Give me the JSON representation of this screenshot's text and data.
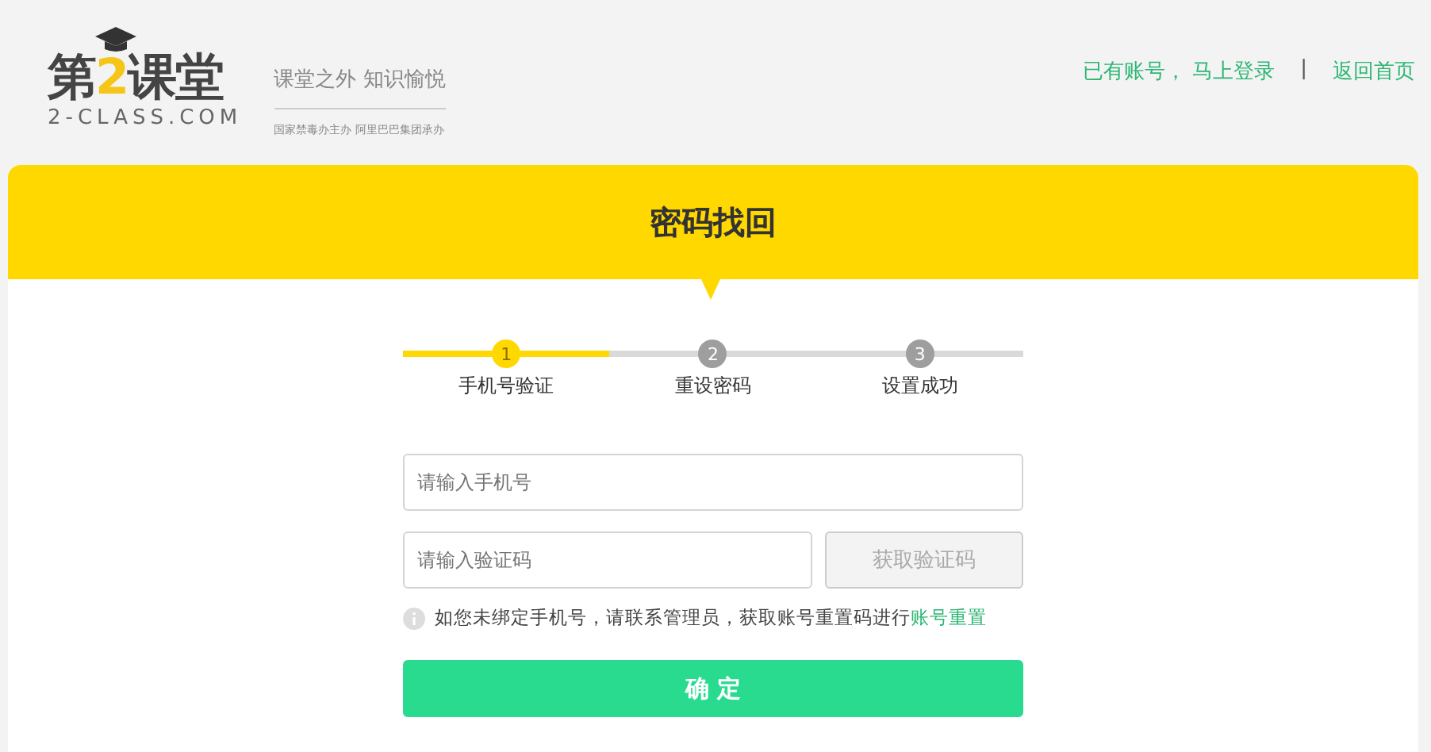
{
  "logo": {
    "name_before": "第",
    "name_digit": "2",
    "name_after": "课堂",
    "domain": "2-CLASS.COM",
    "slogan": "课堂之外  知识愉悦",
    "sponsor": "国家禁毒办主办 阿里巴巴集团承办"
  },
  "header_links": [
    {
      "label": "已有账号， 马上登录"
    },
    {
      "label": "返回首页"
    }
  ],
  "header_separator": "|",
  "title": "密码找回",
  "steps": [
    {
      "number": "1",
      "label": "手机号验证",
      "selected": true
    },
    {
      "number": "2",
      "label": "重设密码",
      "selected": false
    },
    {
      "number": "3",
      "label": "设置成功",
      "selected": false
    }
  ],
  "phone_field": {
    "placeholder": "请输入手机号"
  },
  "code_field": {
    "placeholder": "请输入验证码"
  },
  "get_code_button": {
    "label": "获取验证码",
    "disabled": true
  },
  "notice": {
    "text": "如您未绑定手机号，请联系管理员，获取账号重置码进行",
    "link": "账号重置"
  },
  "submit_button": "确 定"
}
